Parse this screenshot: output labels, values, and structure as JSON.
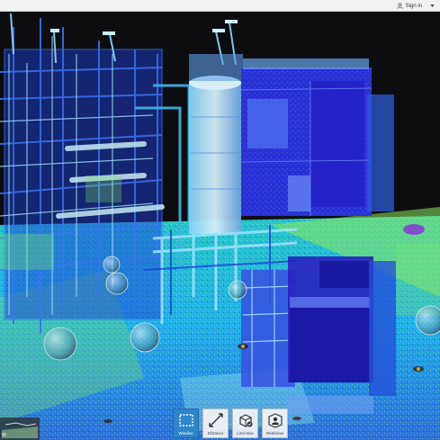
{
  "app": {
    "account": {
      "signin_label": "Sign in",
      "user_icon": "user-icon",
      "menu_icon": "caret-down-icon"
    }
  },
  "toolbar": {
    "tools": [
      {
        "id": "window",
        "label": "Window",
        "icon": "selection-window-icon",
        "active": true
      },
      {
        "id": "distance",
        "label": "Distance",
        "icon": "measure-distance-icon",
        "active": false
      },
      {
        "id": "limitbox",
        "label": "Limit Box",
        "icon": "limit-box-icon",
        "active": false
      },
      {
        "id": "realview",
        "label": "RealView",
        "icon": "realview-icon",
        "active": false
      }
    ]
  },
  "minimap": {
    "label": "W"
  },
  "colors": {
    "active_tool": "#2f86c9",
    "sky": "#0d0d10",
    "intensity_low": "#1a2bd9",
    "intensity_mid": "#27c2e8",
    "intensity_high": "#9cf05a"
  }
}
